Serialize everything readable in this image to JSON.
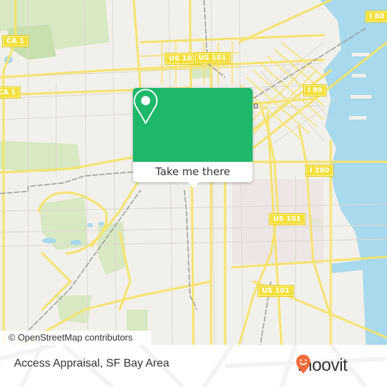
{
  "map": {
    "region": "San Francisco",
    "highway_shields": [
      {
        "label": "CA 1"
      },
      {
        "label": "CA 1"
      },
      {
        "label": "US 101"
      },
      {
        "label": "US 101"
      },
      {
        "label": "I 80"
      },
      {
        "label": "I 80"
      },
      {
        "label": "I 280"
      },
      {
        "label": "US 101"
      },
      {
        "label": "US 101"
      }
    ],
    "partial_label": "o",
    "colors": {
      "land": "#f2f0eb",
      "water": "#a8d9ec",
      "park": "#d7e8c2",
      "road": "#f6e36b",
      "rail": "#9a9a9a"
    }
  },
  "popup": {
    "icon": "location-pin-icon",
    "button_label": "Take me there",
    "accent": "#1db86a"
  },
  "attribution": "© OpenStreetMap contributors",
  "footer": {
    "place_name": "Access Appraisal, SF Bay Area",
    "brand": "moovit",
    "brand_color": "#f26b3a"
  }
}
